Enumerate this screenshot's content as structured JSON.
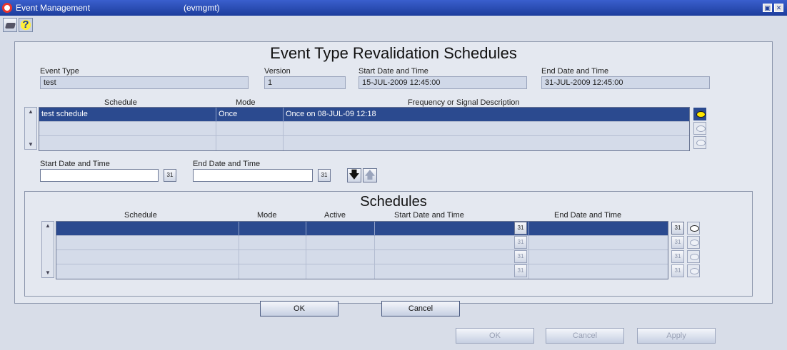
{
  "window": {
    "title": "Event Management",
    "module": "(evmgmt)",
    "maximize_glyph": "▣",
    "close_glyph": "✕"
  },
  "toolbar": {
    "save_icon": "save-icon",
    "help_label": "?"
  },
  "heading": "Event Type Revalidation Schedules",
  "header_fields": {
    "event_type": {
      "label": "Event Type",
      "value": "test"
    },
    "version": {
      "label": "Version",
      "value": "1"
    },
    "start": {
      "label": "Start Date and Time",
      "value": "15-JUL-2009 12:45:00"
    },
    "end": {
      "label": "End Date and Time",
      "value": "31-JUL-2009 12:45:00"
    }
  },
  "schedule_grid": {
    "columns": {
      "schedule": "Schedule",
      "mode": "Mode",
      "description": "Frequency or Signal Description"
    },
    "rows": [
      {
        "schedule": "test schedule",
        "mode": "Once",
        "description": "Once on 08-JUL-09 12:18"
      },
      {
        "schedule": "",
        "mode": "",
        "description": ""
      },
      {
        "schedule": "",
        "mode": "",
        "description": ""
      }
    ]
  },
  "filter": {
    "start_label": "Start Date and Time",
    "end_label": "End Date and Time",
    "start_value": "",
    "end_value": "",
    "calendar_glyph": "31",
    "down_glyph": "🡇",
    "up_glyph": "🡅"
  },
  "schedules": {
    "title": "Schedules",
    "columns": {
      "schedule": "Schedule",
      "mode": "Mode",
      "active": "Active",
      "start": "Start Date and Time",
      "end": "End Date and Time"
    },
    "rows": [
      {
        "schedule": "",
        "mode": "",
        "active": "",
        "start": "",
        "end": ""
      },
      {
        "schedule": "",
        "mode": "",
        "active": "",
        "start": "",
        "end": ""
      },
      {
        "schedule": "",
        "mode": "",
        "active": "",
        "start": "",
        "end": ""
      },
      {
        "schedule": "",
        "mode": "",
        "active": "",
        "start": "",
        "end": ""
      }
    ]
  },
  "buttons": {
    "ok": "OK",
    "cancel": "Cancel",
    "footer_ok": "OK",
    "footer_cancel": "Cancel",
    "footer_apply": "Apply",
    "mnemonic": "_"
  },
  "colors": {
    "title_bar": "#1d3d9c",
    "selected_row": "#2b4a8f",
    "panel": "#e4e8f0"
  }
}
